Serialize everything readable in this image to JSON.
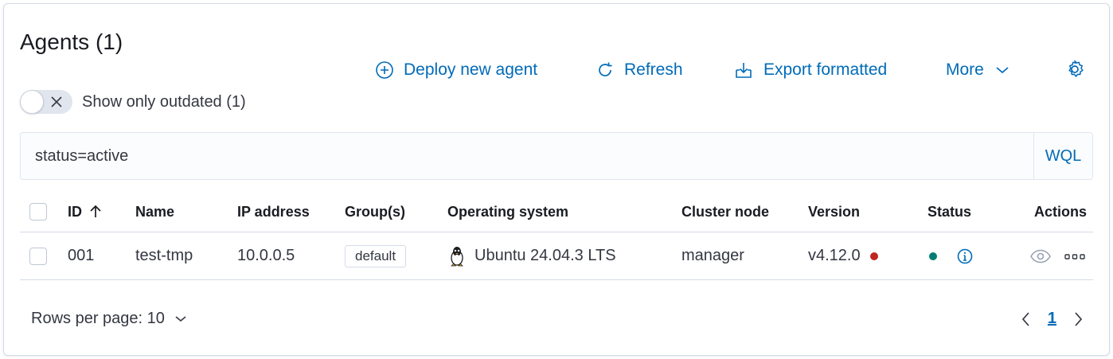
{
  "header": {
    "title": "Agents (1)"
  },
  "actions": {
    "deploy_label": "Deploy new agent",
    "refresh_label": "Refresh",
    "export_label": "Export formatted",
    "more_label": "More"
  },
  "filter": {
    "outdated_toggle_label": "Show only outdated (1)",
    "outdated_toggle_on": false
  },
  "search": {
    "value": "status=active",
    "language_label": "WQL"
  },
  "table": {
    "columns": [
      "ID",
      "Name",
      "IP address",
      "Group(s)",
      "Operating system",
      "Cluster node",
      "Version",
      "Status",
      "Actions"
    ],
    "sort": {
      "column": "ID",
      "direction": "ascending"
    },
    "rows": [
      {
        "id": "001",
        "name": "test-tmp",
        "ip": "10.0.0.5",
        "group": "default",
        "os": "Ubuntu 24.04.3 LTS",
        "os_icon": "linux-tux-icon",
        "node": "manager",
        "version": "v4.12.0",
        "version_dot_color": "#bd271e",
        "status_color": "#017d73"
      }
    ]
  },
  "pagination": {
    "rows_per_page_label": "Rows per page: 10",
    "current_page": "1"
  },
  "colors": {
    "accent": "#006bb8",
    "border": "#d3dae6",
    "text": "#343741"
  }
}
